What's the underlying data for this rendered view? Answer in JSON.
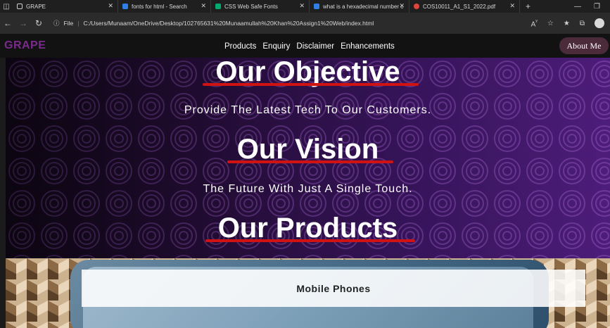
{
  "browser": {
    "tabs": [
      {
        "label": "GRAPE",
        "favicon_color": "#cfcfcf"
      },
      {
        "label": "fonts for html - Search",
        "favicon_color": "#2f7fe6"
      },
      {
        "label": "CSS Web Safe Fonts",
        "favicon_color": "#04aa6d"
      },
      {
        "label": "what is a hexadecimal number c",
        "favicon_color": "#2f7fe6"
      },
      {
        "label": "COS10011_A1_S1_2022.pdf",
        "favicon_color": "#e0443a"
      }
    ],
    "address_prefix": "File",
    "address_url": "C:/Users/Munaam/OneDrive/Desktop/102765631%20Munaamullah%20Khan%20Assign1%20Web/index.html"
  },
  "site": {
    "logo": "GRAPE",
    "nav": {
      "links": [
        "Products",
        "Enquiry",
        "Disclaimer",
        "Enhancements"
      ],
      "about": "About Me"
    },
    "hero": {
      "objective_title": "Our Objective",
      "objective_text": "Provide The Latest Tech To Our Customers.",
      "vision_title": "Our Vision",
      "vision_text": "The Future With Just A Single Touch.",
      "products_title": "Our Products"
    },
    "products": {
      "first_card": "Mobile Phones"
    },
    "colors": {
      "logo": "#7a2a8c",
      "underline": "#d11212",
      "about_bg": "#4b2b3a"
    }
  }
}
